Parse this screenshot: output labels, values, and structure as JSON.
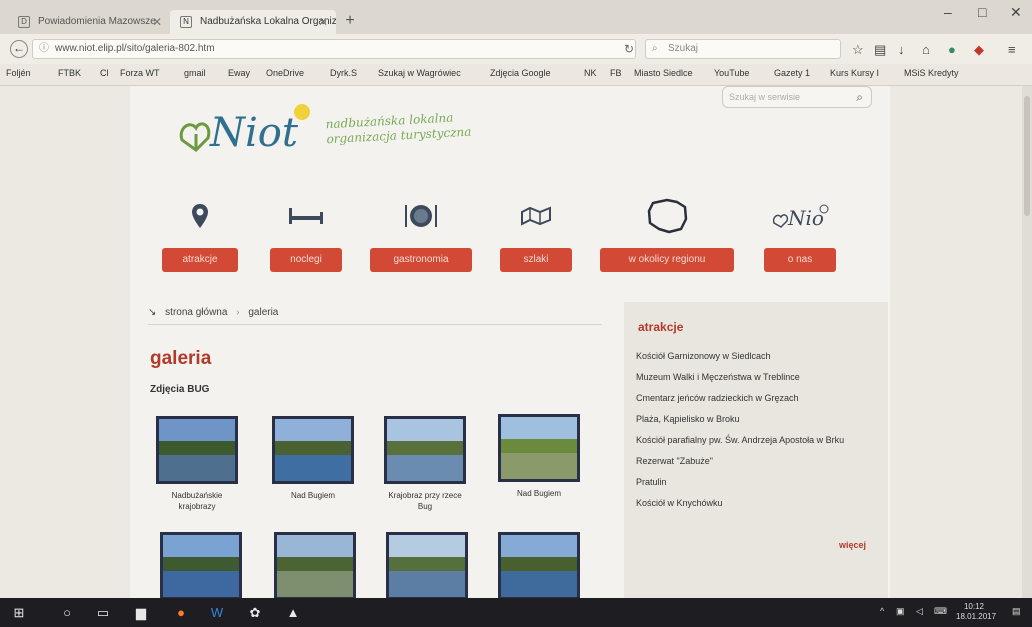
{
  "browser": {
    "tabs": [
      {
        "label": "Powiadomienia Mazowsze"
      },
      {
        "label": "Nadbużańska Lokalna Organizacja"
      }
    ],
    "url": "www.niot.elip.pl/sito/galeria-802.htm",
    "search_placeholder": "Szukaj",
    "bookmarks": [
      "Foljén",
      "FTBK",
      "Cl",
      "Forza WT",
      "gmail",
      "Eway",
      "OneDrive",
      "Dyrk.S",
      "Szukaj w Wagrówiec",
      "Zdjęcia Google",
      "NK",
      "FB",
      "Miasto Siedlce",
      "YouTube",
      "Gazety 1",
      "Kurs Kursy I",
      "MSiS Kredyty"
    ]
  },
  "site": {
    "logo_text": "Niot",
    "tagline": "nadbużańska lokalna organizacja turystyczna",
    "search_placeholder": "Szukaj w serwisie",
    "menu": [
      {
        "label": "atrakcje",
        "icon": "map-pin-icon"
      },
      {
        "label": "noclegi",
        "icon": "bed-icon"
      },
      {
        "label": "gastronomia",
        "icon": "plate-icon"
      },
      {
        "label": "szlaki",
        "icon": "map-icon"
      },
      {
        "label": "w okolicy regionu",
        "icon": "poland-outline-icon"
      },
      {
        "label": "o nas",
        "icon": "niot-logo-icon"
      }
    ],
    "breadcrumb": {
      "home": "strona główna",
      "current": "galeria"
    },
    "heading": "galeria",
    "subheading": "Zdjęcia BUG",
    "gallery": [
      {
        "caption": "Nadbużańskie krajobrazy"
      },
      {
        "caption": "Nad Bugiem"
      },
      {
        "caption": "Krajobraz przy rzece Bug"
      },
      {
        "caption": "Nad Bugiem"
      },
      {
        "caption": ""
      },
      {
        "caption": ""
      },
      {
        "caption": ""
      },
      {
        "caption": ""
      }
    ],
    "sidebar": {
      "title": "atrakcje",
      "items": [
        "Kościół Garnizonowy w Siedlcach",
        "Muzeum Walki i Męczeństwa w Treblince",
        "Cmentarz jeńców radzieckich w Gręzach",
        "Plaża, Kąpielisko w Broku",
        "Kościół parafialny pw. Św. Andrzeja Apostoła w Brku",
        "Rezerwat \"Zabuże\"",
        "Pratulin",
        "Kościół w Knychówku"
      ],
      "more": "więcej"
    }
  },
  "taskbar": {
    "time": "10:12",
    "date": "18.01.2017"
  },
  "colors": {
    "accent_red": "#d24a36",
    "heading_red": "#b33a2a",
    "thumb_border": "#2a2f48"
  }
}
